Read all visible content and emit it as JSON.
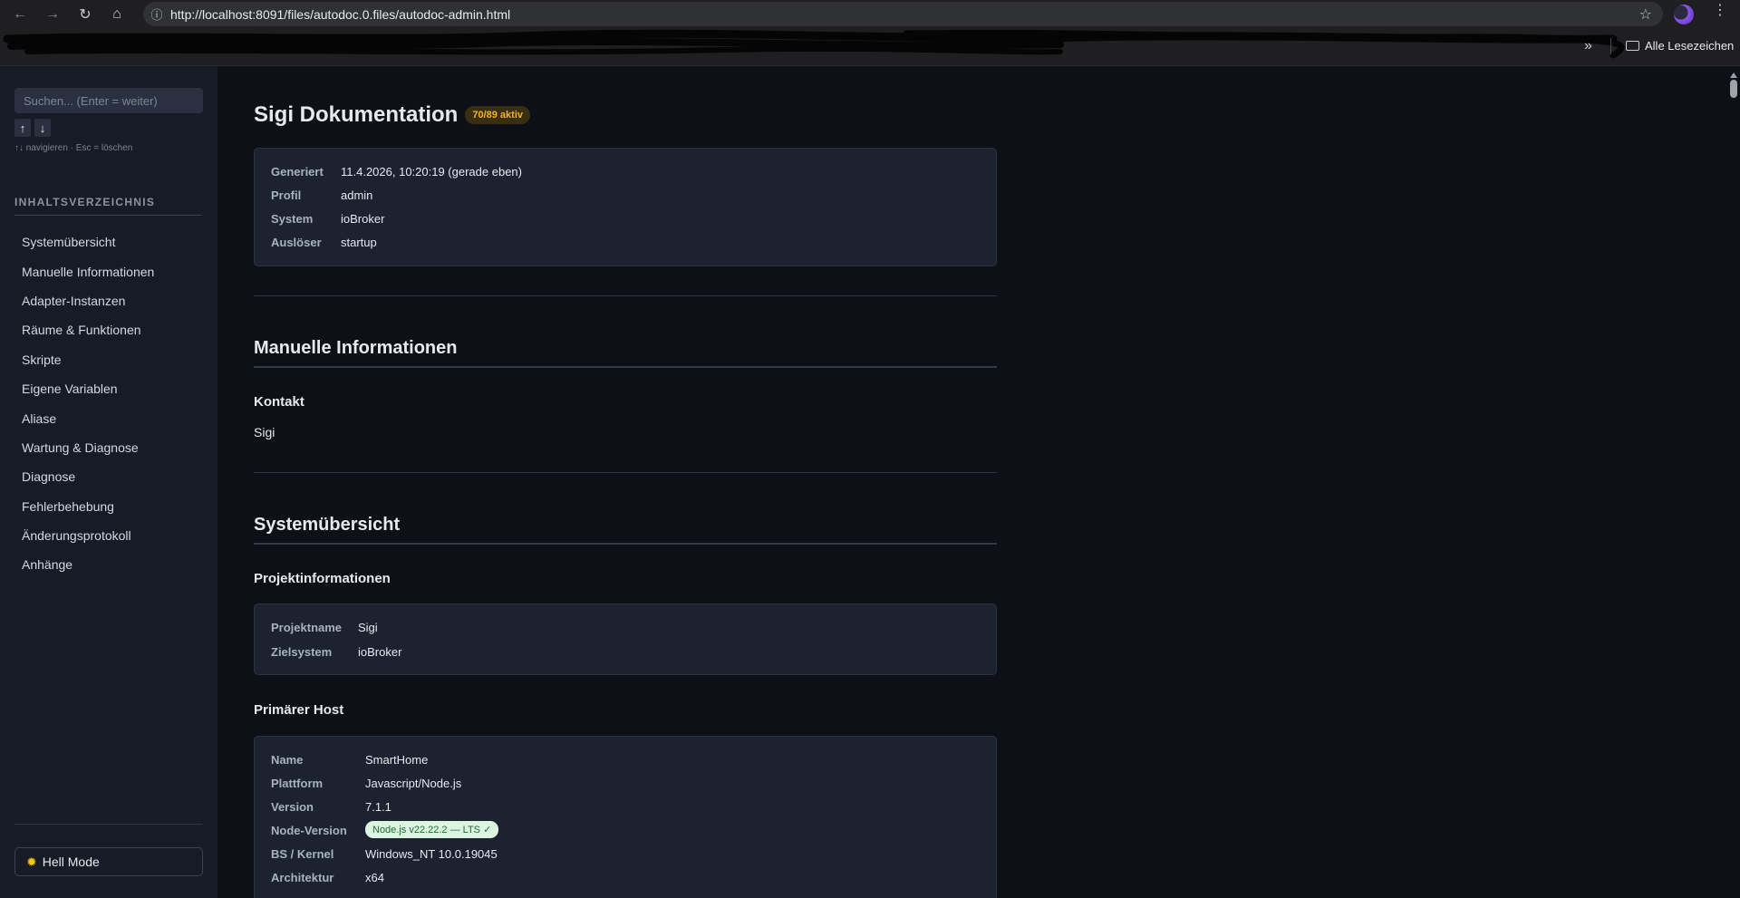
{
  "browser": {
    "url": "http://localhost:8091/files/autodoc.0.files/autodoc-admin.html",
    "bookmarks_folder": "Alle Lesezeichen"
  },
  "sidebar": {
    "search_placeholder": "Suchen... (Enter = weiter)",
    "arrow_up": "↑",
    "arrow_down": "↓",
    "hint": "↑↓ navigieren · Esc = löschen",
    "toc_title": "INHALTSVERZEICHNIS",
    "toc": [
      "Systemübersicht",
      "Manuelle Informationen",
      "Adapter-Instanzen",
      "Räume & Funktionen",
      "Skripte",
      "Eigene Variablen",
      "Aliase",
      "Wartung & Diagnose",
      "Diagnose",
      "Fehlerbehebung",
      "Änderungsprotokoll",
      "Anhänge"
    ],
    "mode_label": "Hell Mode"
  },
  "main": {
    "title": "Sigi Dokumentation",
    "active_badge": "70/89 aktiv",
    "meta": [
      {
        "k": "Generiert",
        "v": "11.4.2026, 10:20:19 (gerade eben)"
      },
      {
        "k": "Profil",
        "v": "admin"
      },
      {
        "k": "System",
        "v": "ioBroker"
      },
      {
        "k": "Auslöser",
        "v": "startup"
      }
    ],
    "manual_section": {
      "title": "Manuelle Informationen",
      "contact_title": "Kontakt",
      "contact_value": "Sigi"
    },
    "system_section": {
      "title": "Systemübersicht",
      "project_title": "Projektinformationen",
      "project": [
        {
          "k": "Projektname",
          "v": "Sigi"
        },
        {
          "k": "Zielsystem",
          "v": "ioBroker"
        }
      ],
      "host_title": "Primärer Host",
      "host": [
        {
          "k": "Name",
          "v": "SmartHome"
        },
        {
          "k": "Plattform",
          "v": "Javascript/Node.js"
        },
        {
          "k": "Version",
          "v": "7.1.1"
        },
        {
          "k": "Node-Version",
          "v": "Node.js v22.22.2 — LTS ✓"
        },
        {
          "k": "BS / Kernel",
          "v": "Windows_NT 10.0.19045"
        },
        {
          "k": "Architektur",
          "v": "x64"
        }
      ]
    }
  }
}
